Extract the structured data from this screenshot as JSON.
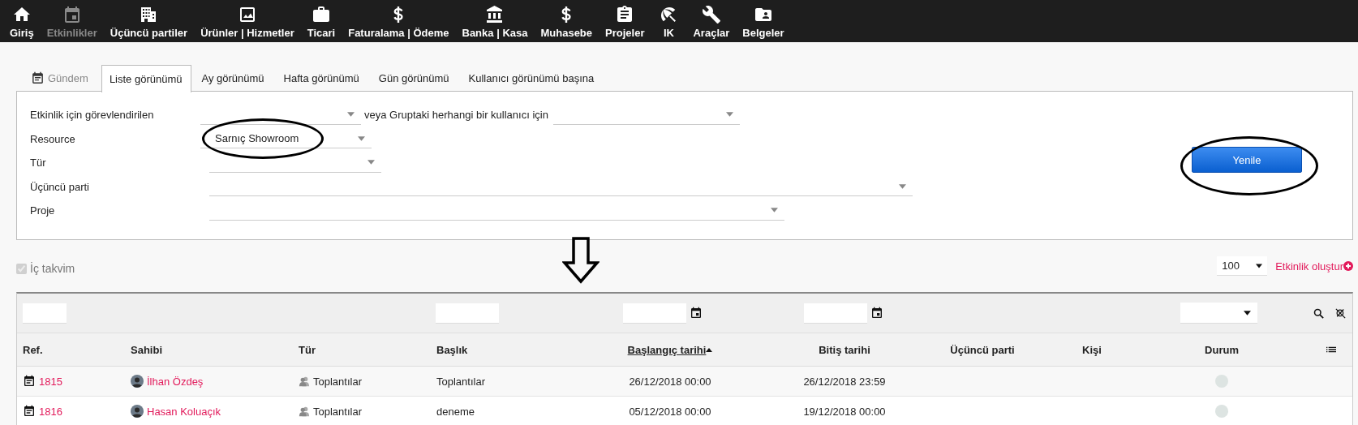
{
  "nav": [
    {
      "label": "Giriş",
      "active": false
    },
    {
      "label": "Etkinlikler",
      "active": true
    },
    {
      "label": "Üçüncü partiler",
      "active": false
    },
    {
      "label": "Ürünler | Hizmetler",
      "active": false
    },
    {
      "label": "Ticari",
      "active": false
    },
    {
      "label": "Faturalama | Ödeme",
      "active": false
    },
    {
      "label": "Banka | Kasa",
      "active": false
    },
    {
      "label": "Muhasebe",
      "active": false
    },
    {
      "label": "Projeler",
      "active": false
    },
    {
      "label": "IK",
      "active": false
    },
    {
      "label": "Araçlar",
      "active": false
    },
    {
      "label": "Belgeler",
      "active": false
    }
  ],
  "agenda_link": {
    "label": "Gündem"
  },
  "tabs": [
    {
      "label": "Liste görünümü",
      "selected": true
    },
    {
      "label": "Ay görünümü",
      "selected": false
    },
    {
      "label": "Hafta görünümü",
      "selected": false
    },
    {
      "label": "Gün görünümü",
      "selected": false
    },
    {
      "label": "Kullanıcı görünümü başına",
      "selected": false
    }
  ],
  "filters": [
    {
      "label": "Etkinlik için görevlendirilen",
      "or_label": "veya Gruptaki herhangi bir kullanıcı için"
    },
    {
      "label": "Resource",
      "value": "Sarnıç Showroom"
    },
    {
      "label": "Tür"
    },
    {
      "label": "Üçüncü parti"
    },
    {
      "label": "Proje"
    }
  ],
  "refresh_button": "Yenile",
  "internal_calendar": {
    "label": "İç takvim",
    "checked": true
  },
  "page_size": "100",
  "create_link": "Etkinlik oluştur",
  "table": {
    "columns": [
      {
        "label": "Ref.",
        "sorted": false
      },
      {
        "label": "Sahibi",
        "sorted": false
      },
      {
        "label": "Tür",
        "sorted": false
      },
      {
        "label": "Başlık",
        "sorted": false
      },
      {
        "label": "Başlangıç tarihi",
        "sorted": true
      },
      {
        "label": "Bitiş tarihi",
        "sorted": false
      },
      {
        "label": "Üçüncü parti",
        "sorted": false
      },
      {
        "label": "Kişi",
        "sorted": false
      },
      {
        "label": "Durum",
        "sorted": false
      }
    ],
    "rows": [
      {
        "ref": "1815",
        "owner": "İlhan Özdeş",
        "type": "Toplantılar",
        "title": "Toplantılar",
        "start": "26/12/2018 00:00",
        "end": "26/12/2018 23:59"
      },
      {
        "ref": "1816",
        "owner": "Hasan Koluaçık",
        "type": "Toplantılar",
        "title": "deneme",
        "start": "05/12/2018 00:00",
        "end": "19/12/2018 00:00"
      }
    ]
  }
}
